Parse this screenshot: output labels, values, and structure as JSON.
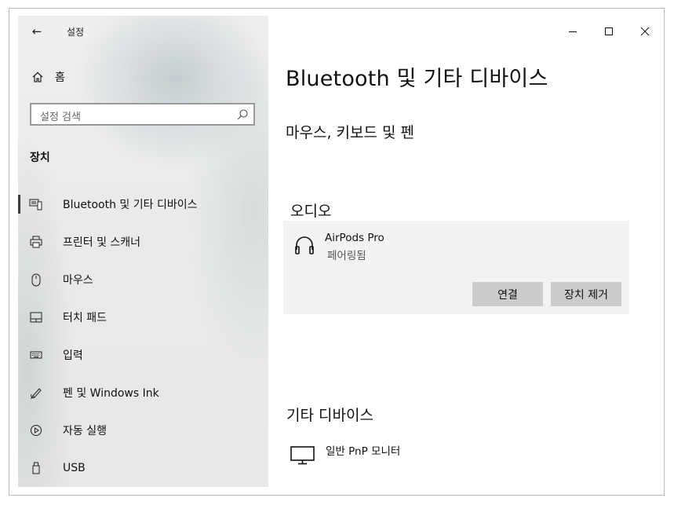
{
  "app": {
    "title": "설정",
    "back_icon": "arrow-left-icon"
  },
  "sidebar": {
    "home_label": "홈",
    "search_placeholder": "설정 검색",
    "section_title": "장치",
    "items": [
      {
        "label": "Bluetooth 및 기타 디바이스",
        "icon": "bluetooth-devices-icon",
        "selected": true
      },
      {
        "label": "프린터 및 스캐너",
        "icon": "printer-icon",
        "selected": false
      },
      {
        "label": "마우스",
        "icon": "mouse-icon",
        "selected": false
      },
      {
        "label": "터치 패드",
        "icon": "touchpad-icon",
        "selected": false
      },
      {
        "label": "입력",
        "icon": "keyboard-icon",
        "selected": false
      },
      {
        "label": "펜 및 Windows Ink",
        "icon": "pen-icon",
        "selected": false
      },
      {
        "label": "자동 실행",
        "icon": "autoplay-icon",
        "selected": false
      },
      {
        "label": "USB",
        "icon": "usb-icon",
        "selected": false
      }
    ]
  },
  "window_controls": [
    "minimize-icon",
    "maximize-icon",
    "close-icon"
  ],
  "main": {
    "title": "Bluetooth 및 기타 디바이스",
    "section_mouse": "마우스, 키보드 및 펜",
    "section_audio": "오디오",
    "audio_device": {
      "name": "AirPods Pro",
      "status": "페어링됨",
      "connect_label": "연결",
      "remove_label": "장치 제거"
    },
    "section_other": "기타 디바이스",
    "other_device": {
      "name": "일반 PnP 모니터"
    }
  },
  "colors": {
    "selected_indicator": "#3c3c3c",
    "card_bg": "#f2f2f2",
    "button_bg": "#cccccc"
  }
}
